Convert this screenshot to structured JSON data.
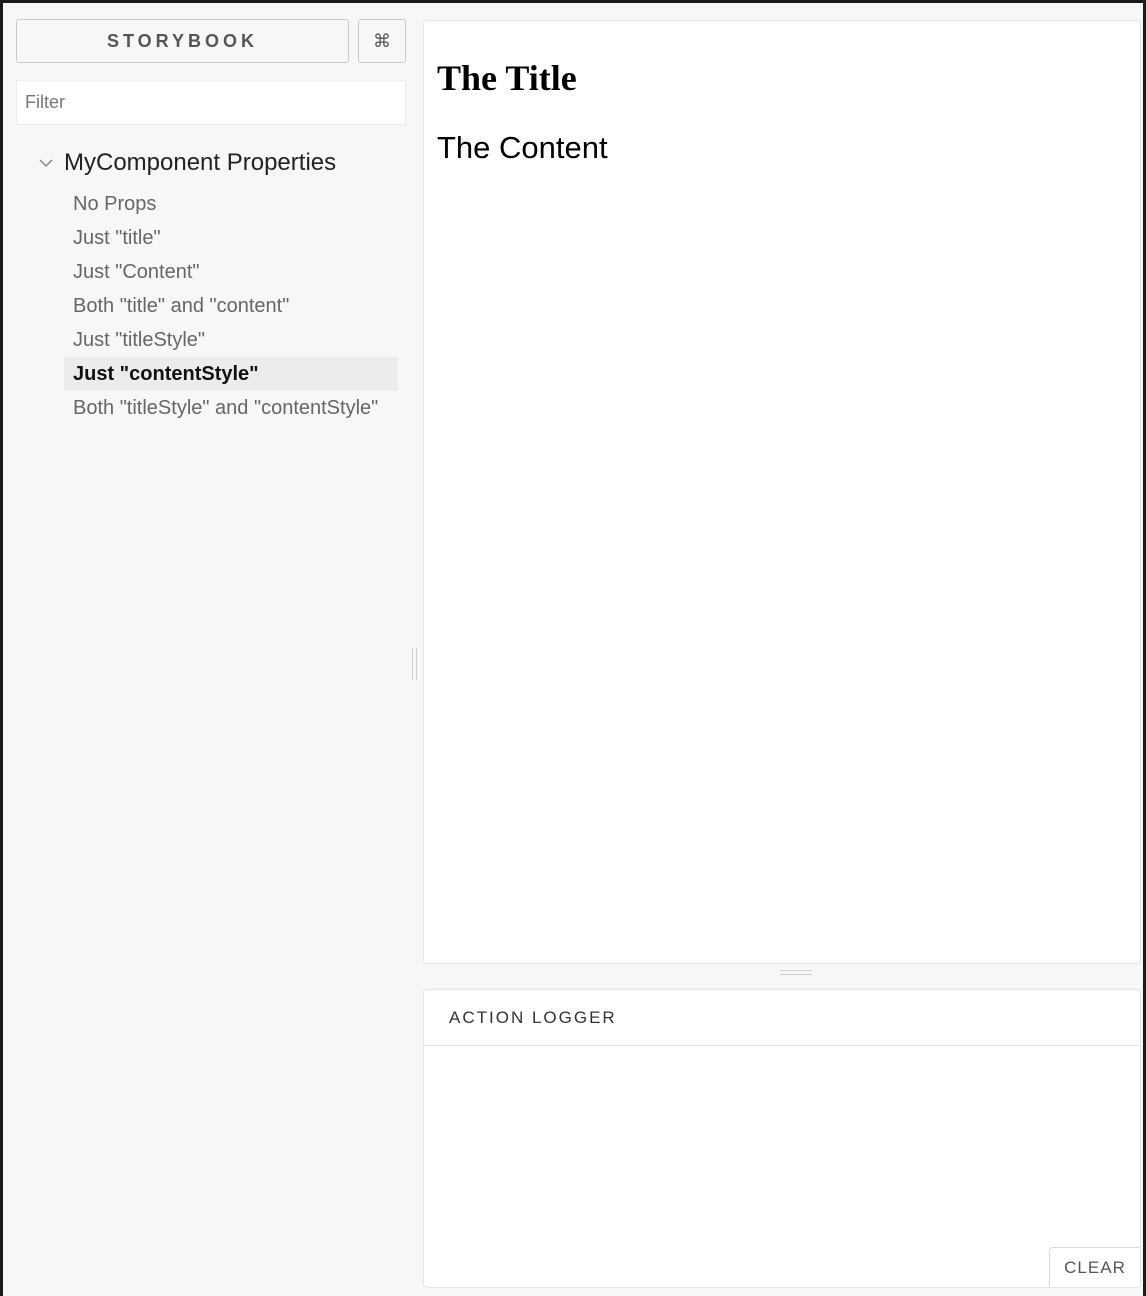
{
  "sidebar": {
    "brand_label": "STORYBOOK",
    "shortcut_label": "⌘",
    "filter": {
      "placeholder": "Filter",
      "value": ""
    },
    "kind": {
      "label": "MyComponent Properties",
      "expanded": true
    },
    "stories": [
      {
        "label": "No Props"
      },
      {
        "label": "Just \"title\""
      },
      {
        "label": "Just \"Content\""
      },
      {
        "label": "Both \"title\" and \"content\""
      },
      {
        "label": "Just \"titleStyle\""
      },
      {
        "label": "Just \"contentStyle\""
      },
      {
        "label": "Both \"titleStyle\" and \"contentStyle\""
      }
    ],
    "active_story_index": 5
  },
  "preview": {
    "title": "The Title",
    "content": "The Content"
  },
  "addon_panel": {
    "tab_label": "ACTION LOGGER",
    "clear_label": "CLEAR"
  },
  "colors": {
    "sidebar_bg": "#f7f7f7",
    "active_item_bg": "#ececec",
    "panel_bg": "#ffffff"
  }
}
